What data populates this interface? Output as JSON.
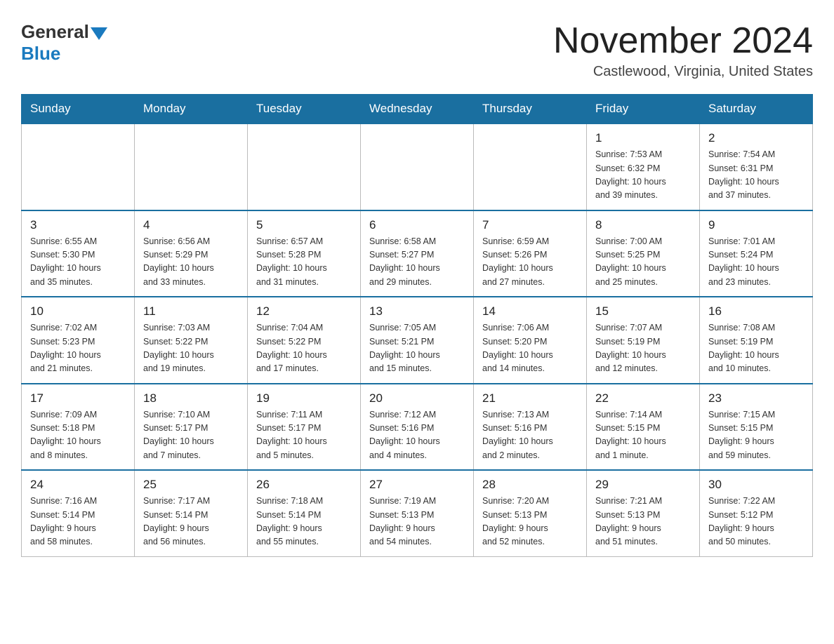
{
  "logo": {
    "general": "General",
    "blue": "Blue"
  },
  "title": {
    "month": "November 2024",
    "location": "Castlewood, Virginia, United States"
  },
  "weekdays": [
    "Sunday",
    "Monday",
    "Tuesday",
    "Wednesday",
    "Thursday",
    "Friday",
    "Saturday"
  ],
  "weeks": [
    [
      {
        "day": "",
        "info": ""
      },
      {
        "day": "",
        "info": ""
      },
      {
        "day": "",
        "info": ""
      },
      {
        "day": "",
        "info": ""
      },
      {
        "day": "",
        "info": ""
      },
      {
        "day": "1",
        "info": "Sunrise: 7:53 AM\nSunset: 6:32 PM\nDaylight: 10 hours\nand 39 minutes."
      },
      {
        "day": "2",
        "info": "Sunrise: 7:54 AM\nSunset: 6:31 PM\nDaylight: 10 hours\nand 37 minutes."
      }
    ],
    [
      {
        "day": "3",
        "info": "Sunrise: 6:55 AM\nSunset: 5:30 PM\nDaylight: 10 hours\nand 35 minutes."
      },
      {
        "day": "4",
        "info": "Sunrise: 6:56 AM\nSunset: 5:29 PM\nDaylight: 10 hours\nand 33 minutes."
      },
      {
        "day": "5",
        "info": "Sunrise: 6:57 AM\nSunset: 5:28 PM\nDaylight: 10 hours\nand 31 minutes."
      },
      {
        "day": "6",
        "info": "Sunrise: 6:58 AM\nSunset: 5:27 PM\nDaylight: 10 hours\nand 29 minutes."
      },
      {
        "day": "7",
        "info": "Sunrise: 6:59 AM\nSunset: 5:26 PM\nDaylight: 10 hours\nand 27 minutes."
      },
      {
        "day": "8",
        "info": "Sunrise: 7:00 AM\nSunset: 5:25 PM\nDaylight: 10 hours\nand 25 minutes."
      },
      {
        "day": "9",
        "info": "Sunrise: 7:01 AM\nSunset: 5:24 PM\nDaylight: 10 hours\nand 23 minutes."
      }
    ],
    [
      {
        "day": "10",
        "info": "Sunrise: 7:02 AM\nSunset: 5:23 PM\nDaylight: 10 hours\nand 21 minutes."
      },
      {
        "day": "11",
        "info": "Sunrise: 7:03 AM\nSunset: 5:22 PM\nDaylight: 10 hours\nand 19 minutes."
      },
      {
        "day": "12",
        "info": "Sunrise: 7:04 AM\nSunset: 5:22 PM\nDaylight: 10 hours\nand 17 minutes."
      },
      {
        "day": "13",
        "info": "Sunrise: 7:05 AM\nSunset: 5:21 PM\nDaylight: 10 hours\nand 15 minutes."
      },
      {
        "day": "14",
        "info": "Sunrise: 7:06 AM\nSunset: 5:20 PM\nDaylight: 10 hours\nand 14 minutes."
      },
      {
        "day": "15",
        "info": "Sunrise: 7:07 AM\nSunset: 5:19 PM\nDaylight: 10 hours\nand 12 minutes."
      },
      {
        "day": "16",
        "info": "Sunrise: 7:08 AM\nSunset: 5:19 PM\nDaylight: 10 hours\nand 10 minutes."
      }
    ],
    [
      {
        "day": "17",
        "info": "Sunrise: 7:09 AM\nSunset: 5:18 PM\nDaylight: 10 hours\nand 8 minutes."
      },
      {
        "day": "18",
        "info": "Sunrise: 7:10 AM\nSunset: 5:17 PM\nDaylight: 10 hours\nand 7 minutes."
      },
      {
        "day": "19",
        "info": "Sunrise: 7:11 AM\nSunset: 5:17 PM\nDaylight: 10 hours\nand 5 minutes."
      },
      {
        "day": "20",
        "info": "Sunrise: 7:12 AM\nSunset: 5:16 PM\nDaylight: 10 hours\nand 4 minutes."
      },
      {
        "day": "21",
        "info": "Sunrise: 7:13 AM\nSunset: 5:16 PM\nDaylight: 10 hours\nand 2 minutes."
      },
      {
        "day": "22",
        "info": "Sunrise: 7:14 AM\nSunset: 5:15 PM\nDaylight: 10 hours\nand 1 minute."
      },
      {
        "day": "23",
        "info": "Sunrise: 7:15 AM\nSunset: 5:15 PM\nDaylight: 9 hours\nand 59 minutes."
      }
    ],
    [
      {
        "day": "24",
        "info": "Sunrise: 7:16 AM\nSunset: 5:14 PM\nDaylight: 9 hours\nand 58 minutes."
      },
      {
        "day": "25",
        "info": "Sunrise: 7:17 AM\nSunset: 5:14 PM\nDaylight: 9 hours\nand 56 minutes."
      },
      {
        "day": "26",
        "info": "Sunrise: 7:18 AM\nSunset: 5:14 PM\nDaylight: 9 hours\nand 55 minutes."
      },
      {
        "day": "27",
        "info": "Sunrise: 7:19 AM\nSunset: 5:13 PM\nDaylight: 9 hours\nand 54 minutes."
      },
      {
        "day": "28",
        "info": "Sunrise: 7:20 AM\nSunset: 5:13 PM\nDaylight: 9 hours\nand 52 minutes."
      },
      {
        "day": "29",
        "info": "Sunrise: 7:21 AM\nSunset: 5:13 PM\nDaylight: 9 hours\nand 51 minutes."
      },
      {
        "day": "30",
        "info": "Sunrise: 7:22 AM\nSunset: 5:12 PM\nDaylight: 9 hours\nand 50 minutes."
      }
    ]
  ]
}
